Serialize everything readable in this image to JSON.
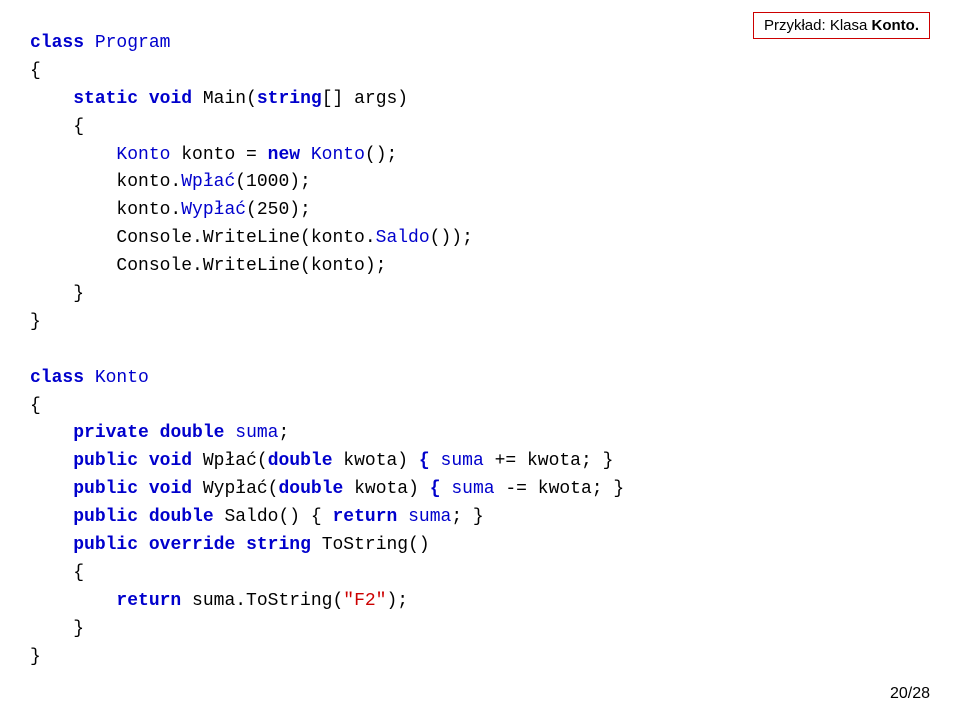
{
  "label": {
    "prefix": "Przykład: Klasa ",
    "bold": "Konto."
  },
  "page": {
    "current": 20,
    "total": 28,
    "display": "20/28"
  },
  "code": {
    "lines": [
      {
        "id": 1,
        "text": "class Program"
      },
      {
        "id": 2,
        "text": "{"
      },
      {
        "id": 3,
        "text": "    static void Main(string[] args)"
      },
      {
        "id": 4,
        "text": "    {"
      },
      {
        "id": 5,
        "text": "        Konto konto = new Konto();"
      },
      {
        "id": 6,
        "text": "        konto.Wpłać(1000);"
      },
      {
        "id": 7,
        "text": "        konto.Wypłać(250);"
      },
      {
        "id": 8,
        "text": "        Console.WriteLine(konto.Saldo());"
      },
      {
        "id": 9,
        "text": "        Console.WriteLine(konto);"
      },
      {
        "id": 10,
        "text": "    }"
      },
      {
        "id": 11,
        "text": "}"
      },
      {
        "id": 12,
        "text": ""
      },
      {
        "id": 13,
        "text": "class Konto"
      },
      {
        "id": 14,
        "text": "{"
      },
      {
        "id": 15,
        "text": "    private double suma;"
      },
      {
        "id": 16,
        "text": "    public void Wpłać(double kwota) { suma += kwota; }"
      },
      {
        "id": 17,
        "text": "    public void Wypłać(double kwota) { suma -= kwota; }"
      },
      {
        "id": 18,
        "text": "    public double Saldo() { return suma; }"
      },
      {
        "id": 19,
        "text": "    public override string ToString()"
      },
      {
        "id": 20,
        "text": "    {"
      },
      {
        "id": 21,
        "text": "        return suma.ToString(\"F2\");"
      },
      {
        "id": 22,
        "text": "    }"
      },
      {
        "id": 23,
        "text": "}"
      }
    ]
  }
}
